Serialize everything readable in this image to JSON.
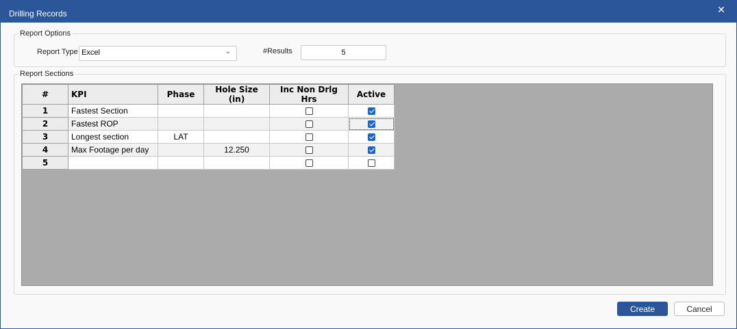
{
  "window": {
    "title": "Drilling Records",
    "close_glyph": "✕"
  },
  "report_options": {
    "legend": "Report Options",
    "report_type_label": "Report Type",
    "report_type_value": "Excel",
    "results_label": "#Results",
    "results_value": "5"
  },
  "report_sections": {
    "legend": "Report Sections",
    "columns": [
      "#",
      "KPI",
      "Phase",
      "Hole Size (in)",
      "Inc Non Drlg Hrs",
      "Active"
    ],
    "rows": [
      {
        "num": "1",
        "kpi": "Fastest Section",
        "phase": "",
        "hole_size": "",
        "inc_non_drlg": false,
        "active": true
      },
      {
        "num": "2",
        "kpi": "Fastest ROP",
        "phase": "",
        "hole_size": "",
        "inc_non_drlg": false,
        "active": true
      },
      {
        "num": "3",
        "kpi": "Longest section",
        "phase": "LAT",
        "hole_size": "",
        "inc_non_drlg": false,
        "active": true
      },
      {
        "num": "4",
        "kpi": "Max Footage per day",
        "phase": "",
        "hole_size": "12.250",
        "inc_non_drlg": false,
        "active": true
      },
      {
        "num": "5",
        "kpi": "",
        "phase": "",
        "hole_size": "",
        "inc_non_drlg": false,
        "active": false
      }
    ]
  },
  "buttons": {
    "create": "Create",
    "cancel": "Cancel"
  },
  "colors": {
    "titlebar": "#2b579a",
    "primary_button": "#2b579a",
    "checkbox_checked": "#1a67c7",
    "grid_background": "#ababab"
  }
}
